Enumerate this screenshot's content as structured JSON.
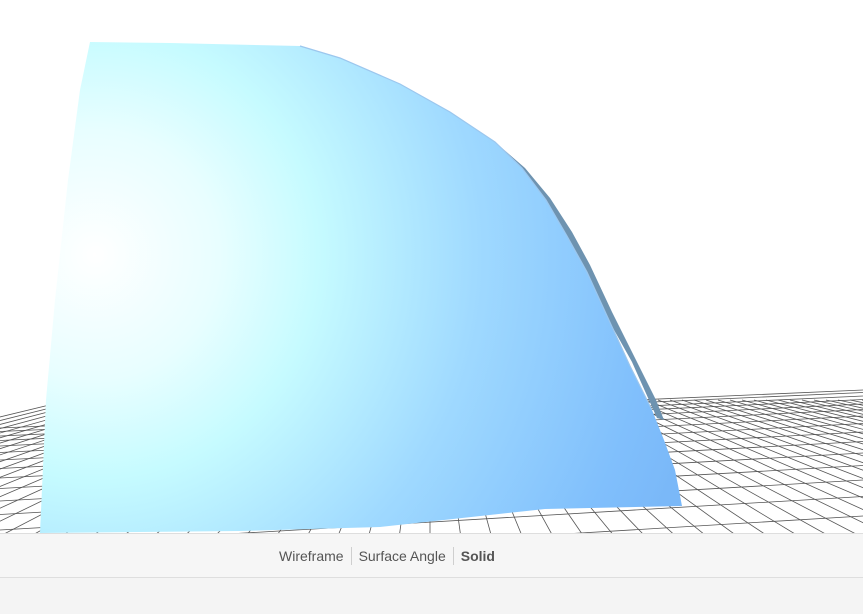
{
  "viewer": {
    "mesh_colors": {
      "highlight": "#ffffff",
      "light": "#c8fbff",
      "mid": "#a6deff",
      "shade": "#7fbdfb",
      "edge": "#6e93b0"
    },
    "grid_color": "#555555"
  },
  "toolbar": {
    "modes": [
      {
        "label": "Wireframe",
        "active": false
      },
      {
        "label": "Surface Angle",
        "active": false
      },
      {
        "label": "Solid",
        "active": true
      }
    ]
  }
}
